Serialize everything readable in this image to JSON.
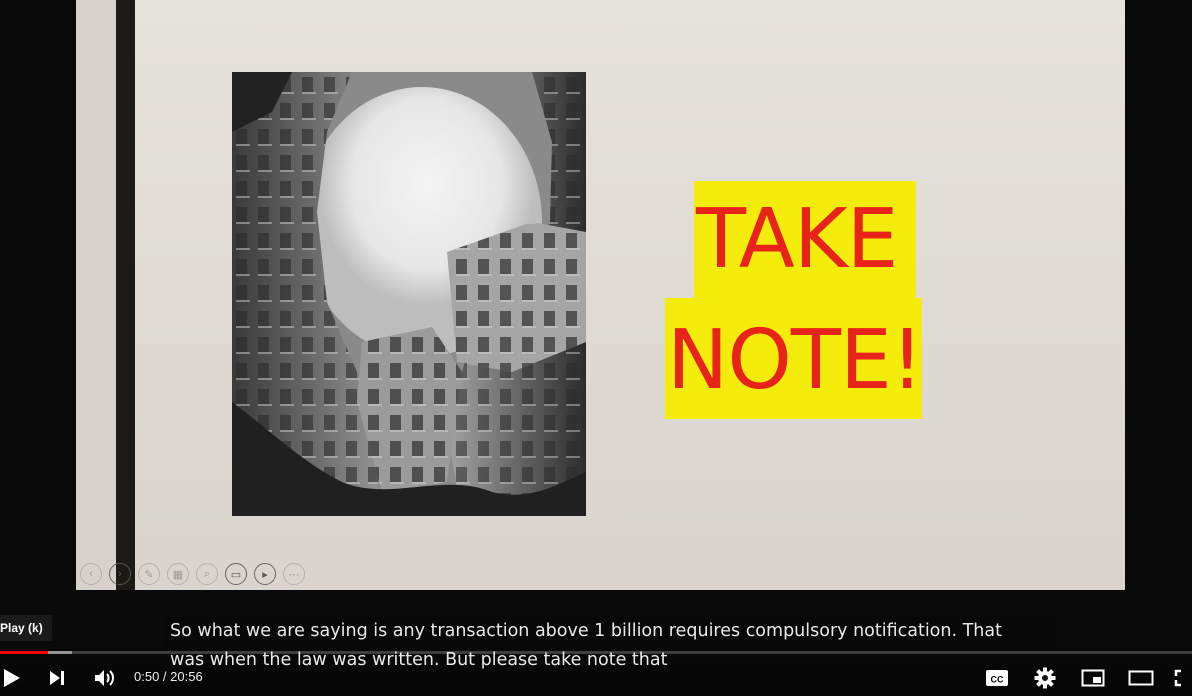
{
  "slide": {
    "note_line_1": "TAKE",
    "note_line_2": "NOTE!",
    "note_text_color": "#e8231a",
    "note_highlight_color": "#f4ec0a"
  },
  "tooltip": {
    "text": "Play (k)"
  },
  "captions": {
    "line_1": "So what we are saying is any transaction above 1 billion requires compulsory notification. That",
    "line_2": "was when the law was written. But please take note that"
  },
  "player": {
    "current_time": "0:50",
    "separator": " / ",
    "duration": "20:56",
    "progress_played_fraction": 0.04,
    "progress_loaded_fraction": 0.06,
    "progress_color": "#ff0000",
    "icons": {
      "play": "play-icon",
      "next": "next-icon",
      "volume": "volume-icon",
      "captions": "cc-icon",
      "settings": "gear-icon",
      "miniplayer": "miniplayer-icon",
      "theater": "theater-mode-icon",
      "fullscreen": "fullscreen-icon"
    }
  }
}
